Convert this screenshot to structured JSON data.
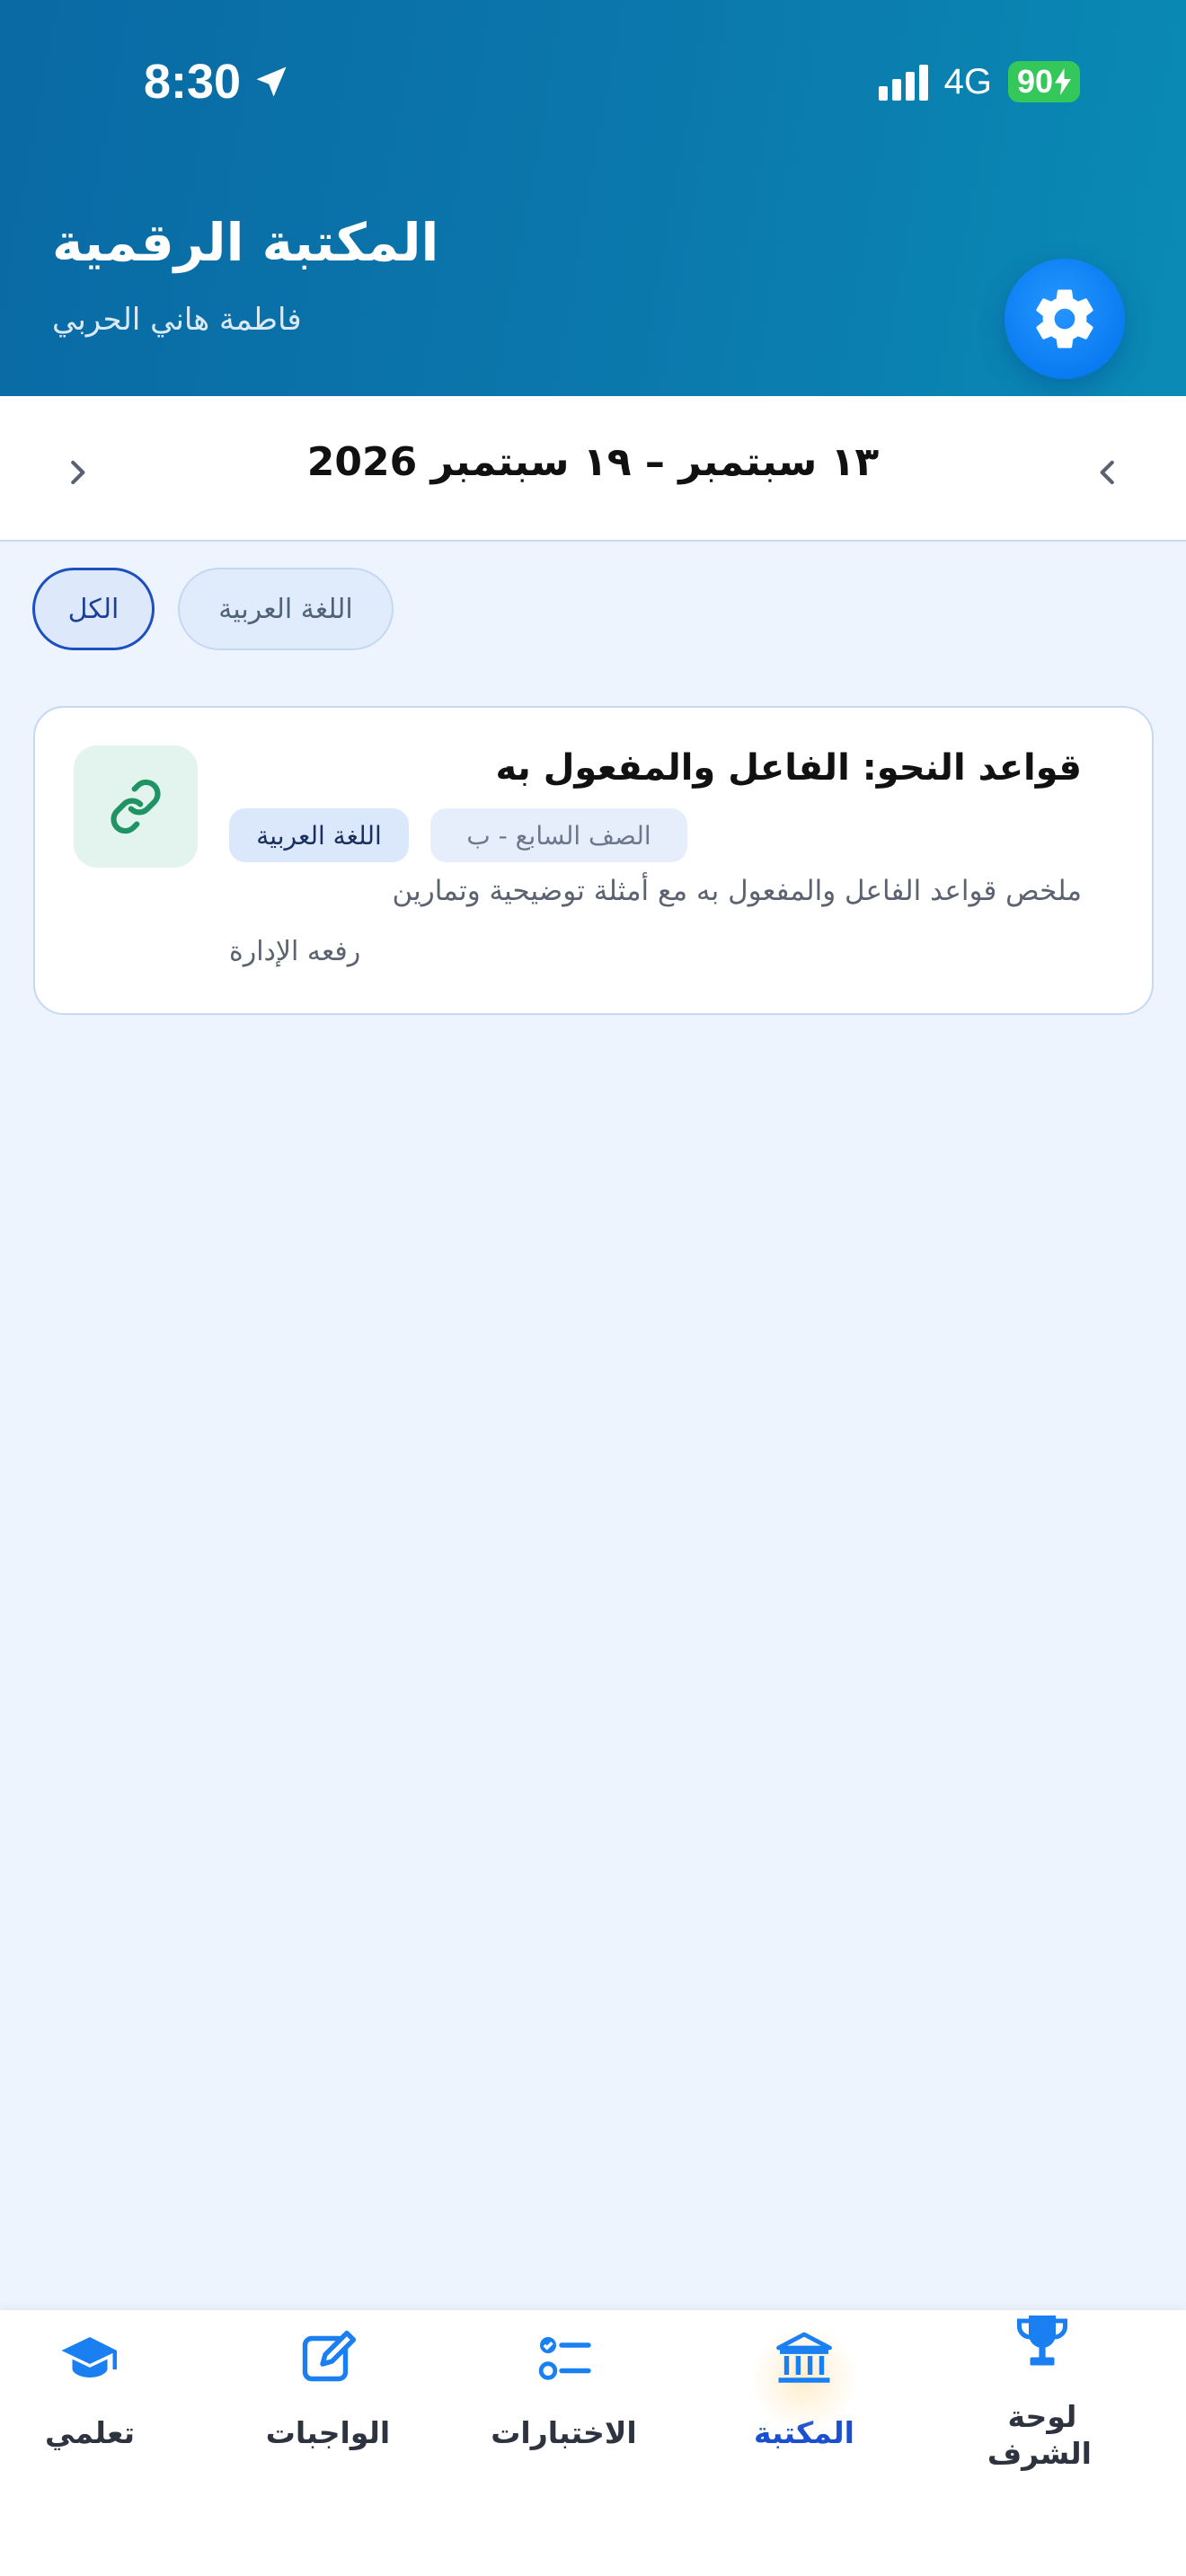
{
  "status_bar": {
    "time": "8:30",
    "network": "4G",
    "battery": "90"
  },
  "header": {
    "title": "المكتبة الرقمية",
    "subtitle": "فاطمة هاني الحربي",
    "settings_icon": "gear-icon",
    "background_color": "#0b78ac"
  },
  "date_nav": {
    "range": "١٣ سبتمبر – ١٩ سبتمبر 2026",
    "prev_icon": "chevron-left-icon",
    "next_icon": "chevron-right-icon"
  },
  "filters": {
    "items": [
      {
        "label": "الكل",
        "selected": true
      },
      {
        "label": "اللغة العربية",
        "selected": false
      }
    ]
  },
  "resources": [
    {
      "title": "قواعد النحو: الفاعل والمفعول به",
      "class_tag": "الصف السابع - ب",
      "subject_tag": "اللغة العربية",
      "description": "ملخص قواعد الفاعل والمفعول به مع أمثلة توضيحية وتمارين",
      "uploader": "رفعه الإدارة",
      "type_icon": "link-icon"
    }
  ],
  "bottom_nav": {
    "active": "library",
    "accent_color": "#1a4fd0",
    "tabs": [
      {
        "id": "learn",
        "label": "تعلمي",
        "icon": "graduation-cap-icon"
      },
      {
        "id": "homework",
        "label": "الواجبات",
        "icon": "edit-icon"
      },
      {
        "id": "tests",
        "label": "الاختبارات",
        "icon": "checklist-icon"
      },
      {
        "id": "library",
        "label": "المكتبة",
        "icon": "library-icon"
      },
      {
        "id": "honor",
        "label": "لوحة الشرف",
        "icon": "trophy-icon"
      }
    ]
  }
}
